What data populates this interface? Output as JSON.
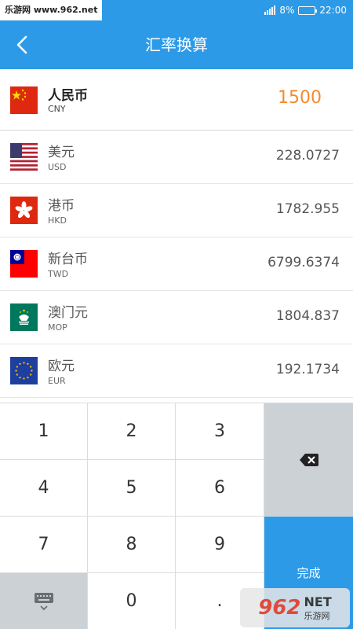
{
  "status_bar": {
    "site_text": "乐游网 www.962.net",
    "battery_text": "8%",
    "time": "22:00",
    "battery_fill_fraction": 0.08
  },
  "app_bar": {
    "title": "汇率换算",
    "back_icon": "chevron-left-icon"
  },
  "currencies": [
    {
      "name": "人民币",
      "code": "CNY",
      "amount": "1500",
      "flag_icon": "china-flag-icon"
    },
    {
      "name": "美元",
      "code": "USD",
      "amount": "228.0727",
      "flag_icon": "usa-flag-icon"
    },
    {
      "name": "港币",
      "code": "HKD",
      "amount": "1782.955",
      "flag_icon": "hong-kong-flag-icon"
    },
    {
      "name": "新台币",
      "code": "TWD",
      "amount": "6799.6374",
      "flag_icon": "taiwan-flag-icon"
    },
    {
      "name": "澳门元",
      "code": "MOP",
      "amount": "1804.837",
      "flag_icon": "macau-flag-icon"
    },
    {
      "name": "欧元",
      "code": "EUR",
      "amount": "192.1734",
      "flag_icon": "eu-flag-icon"
    }
  ],
  "keypad": {
    "k1": "1",
    "k2": "2",
    "k3": "3",
    "k4": "4",
    "k5": "5",
    "k6": "6",
    "k7": "7",
    "k8": "8",
    "k9": "9",
    "k0": "0",
    "dot": ".",
    "done": "完成",
    "backspace_icon": "backspace-icon",
    "hide_keyboard_icon": "keyboard-hide-icon"
  },
  "watermark": {
    "big": "962",
    "net": "NET",
    "sub": "乐游网"
  },
  "colors": {
    "primary": "#2d9ae8",
    "accent_amount": "#f38a2e"
  }
}
